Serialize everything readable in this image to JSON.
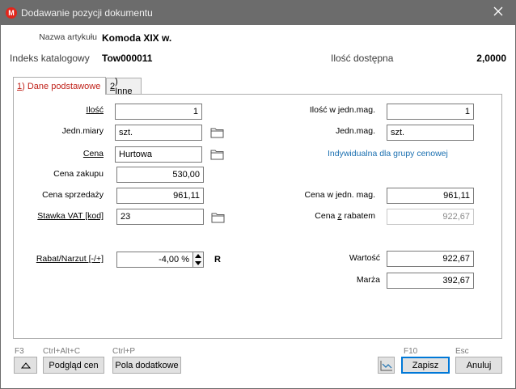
{
  "window": {
    "title": "Dodawanie pozycji dokumentu",
    "app_icon_letter": "M"
  },
  "header": {
    "name_label": "Nazwa artykułu",
    "name_value": "Komoda XIX w.",
    "index_label": "Indeks katalogowy",
    "index_value": "Tow000011",
    "available_label": "Ilość dostępna",
    "available_value": "2,0000"
  },
  "tabs": [
    {
      "number": "1",
      "label": ") Dane podstawowe"
    },
    {
      "number": "2",
      "label": ") Inne"
    }
  ],
  "form": {
    "qty_label": "Ilość",
    "qty_value": "1",
    "unit_label": "Jedn.miary",
    "unit_value": "szt.",
    "price_label": "Cena",
    "price_value": "Hurtowa",
    "purchase_price_label": "Cena zakupu",
    "purchase_price_value": "530,00",
    "sale_price_label": "Cena sprzedaży",
    "sale_price_value": "961,11",
    "vat_label": "Stawka VAT [kod]",
    "vat_value": "23",
    "discount_label": "Rabat/Narzut [-/+]",
    "discount_value": "-4,00",
    "discount_unit": "%",
    "discount_flag": "R",
    "qty_mag_label": "Ilość w jedn.mag.",
    "qty_mag_value": "1",
    "unit_mag_label": "Jedn.mag.",
    "unit_mag_value": "szt.",
    "individual_link": "Indywidualna dla grupy cenowej",
    "price_mag_label": "Cena w jedn. mag.",
    "price_mag_value": "961,11",
    "discounted_price_label": "Cena z rabatem",
    "discounted_price_value": "922,67",
    "value_label": "Wartość",
    "value_value": "922,67",
    "margin_label": "Marża",
    "margin_value": "392,67"
  },
  "footer": {
    "collapse_shortcut": "F3",
    "preview_shortcut": "Ctrl+Alt+C",
    "preview_label": "Podgląd cen",
    "extra_shortcut": "Ctrl+P",
    "extra_label": "Pola dodatkowe",
    "save_shortcut": "F10",
    "save_label": "Zapisz",
    "cancel_shortcut": "Esc",
    "cancel_label": "Anuluj"
  },
  "colors": {
    "titlebar": "#6c6c6c",
    "accent_red": "#c0221a",
    "link_blue": "#1a6fb0"
  }
}
